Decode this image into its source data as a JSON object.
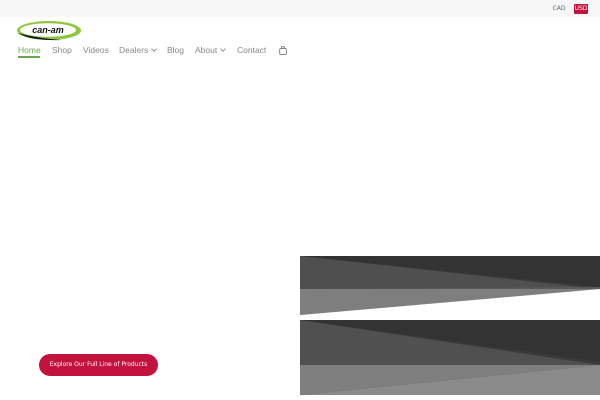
{
  "currency": {
    "cad": "CAD",
    "usd": "USD"
  },
  "brand": {
    "logo_text": "can-am"
  },
  "nav": {
    "items": [
      {
        "label": "Home"
      },
      {
        "label": "Shop"
      },
      {
        "label": "Videos"
      },
      {
        "label": "Dealers"
      },
      {
        "label": "Blog"
      },
      {
        "label": "About"
      },
      {
        "label": "Contact"
      }
    ]
  },
  "hero": {
    "cta_label": "Explore Our Full Line of Products"
  },
  "colors": {
    "accent": "#c4123f",
    "nav_active": "#6aa84f",
    "logo_green": "#8dc63f"
  },
  "icons": {
    "cart": "shopping-bag-icon",
    "dropdown": "chevron-down-icon"
  }
}
